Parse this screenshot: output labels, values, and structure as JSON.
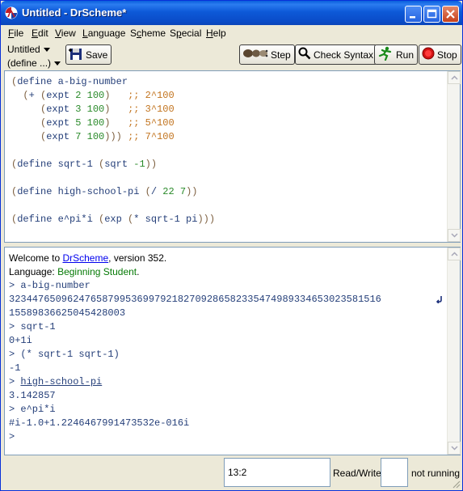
{
  "window": {
    "title": "Untitled - DrScheme*"
  },
  "menu": [
    {
      "pre": "",
      "u": "F",
      "post": "ile"
    },
    {
      "pre": "",
      "u": "E",
      "post": "dit"
    },
    {
      "pre": "",
      "u": "V",
      "post": "iew"
    },
    {
      "pre": "",
      "u": "L",
      "post": "anguage"
    },
    {
      "pre": "S",
      "u": "c",
      "post": "heme"
    },
    {
      "pre": "S",
      "u": "p",
      "post": "ecial"
    },
    {
      "pre": "",
      "u": "H",
      "post": "elp"
    }
  ],
  "toolbar": {
    "file_dropdown": "Untitled",
    "define_dropdown": "(define ...)",
    "save_label": "Save",
    "step_label": "Step",
    "check_syntax_label": "Check Syntax",
    "run_label": "Run",
    "stop_label": "Stop"
  },
  "definitions": [
    [
      [
        "c-paren",
        "("
      ],
      [
        "c-kw",
        "define a-big-number"
      ]
    ],
    [
      [
        "c-txt",
        "  "
      ],
      [
        "c-paren",
        "("
      ],
      [
        "c-kw",
        "+ "
      ],
      [
        "c-paren",
        "("
      ],
      [
        "c-kw",
        "expt "
      ],
      [
        "c-num",
        "2 100"
      ],
      [
        "c-paren",
        ")"
      ],
      [
        "c-txt",
        "   "
      ],
      [
        "c-cmt",
        ";; 2^100"
      ]
    ],
    [
      [
        "c-txt",
        "     "
      ],
      [
        "c-paren",
        "("
      ],
      [
        "c-kw",
        "expt "
      ],
      [
        "c-num",
        "3 100"
      ],
      [
        "c-paren",
        ")"
      ],
      [
        "c-txt",
        "   "
      ],
      [
        "c-cmt",
        ";; 3^100"
      ]
    ],
    [
      [
        "c-txt",
        "     "
      ],
      [
        "c-paren",
        "("
      ],
      [
        "c-kw",
        "expt "
      ],
      [
        "c-num",
        "5 100"
      ],
      [
        "c-paren",
        ")"
      ],
      [
        "c-txt",
        "   "
      ],
      [
        "c-cmt",
        ";; 5^100"
      ]
    ],
    [
      [
        "c-txt",
        "     "
      ],
      [
        "c-paren",
        "("
      ],
      [
        "c-kw",
        "expt "
      ],
      [
        "c-num",
        "7 100"
      ],
      [
        "c-paren",
        ")))"
      ],
      [
        "c-txt",
        " "
      ],
      [
        "c-cmt",
        ";; 7^100"
      ]
    ],
    [],
    [
      [
        "c-paren",
        "("
      ],
      [
        "c-kw",
        "define sqrt-1 "
      ],
      [
        "c-paren",
        "("
      ],
      [
        "c-kw",
        "sqrt "
      ],
      [
        "c-num",
        "-1"
      ],
      [
        "c-paren",
        "))"
      ]
    ],
    [],
    [
      [
        "c-paren",
        "("
      ],
      [
        "c-kw",
        "define high-school-pi "
      ],
      [
        "c-paren",
        "("
      ],
      [
        "c-kw",
        "/ "
      ],
      [
        "c-num",
        "22 7"
      ],
      [
        "c-paren",
        "))"
      ]
    ],
    [],
    [
      [
        "c-paren",
        "("
      ],
      [
        "c-kw",
        "define e^pi*i "
      ],
      [
        "c-paren",
        "("
      ],
      [
        "c-kw",
        "exp "
      ],
      [
        "c-paren",
        "("
      ],
      [
        "c-kw",
        "* sqrt-1 pi"
      ],
      [
        "c-paren",
        ")))"
      ]
    ]
  ],
  "repl": {
    "welcome_prefix": "Welcome to ",
    "welcome_link": "DrScheme",
    "welcome_suffix": ", version 352.",
    "language_prefix": "Language: ",
    "language_name": "Beginning Student",
    "language_suffix": ".",
    "lines": [
      "> a-big-number",
      "3234476509624765879953699792182709286582335474989334653023581516",
      "15589836625045428003",
      "> sqrt-1",
      "0+1i",
      "> (* sqrt-1 sqrt-1)",
      "-1",
      "> high-school-pi",
      "3.142857",
      "> e^pi*i",
      "#i-1.0+1.2246467991473532e-016i",
      ">"
    ]
  },
  "status": {
    "position": "13:2",
    "mode": "Read/Write",
    "running": "not running"
  },
  "colors": {
    "titlebar": "#0a5fdc",
    "language_name": "#067a06",
    "link": "#0000ee"
  }
}
